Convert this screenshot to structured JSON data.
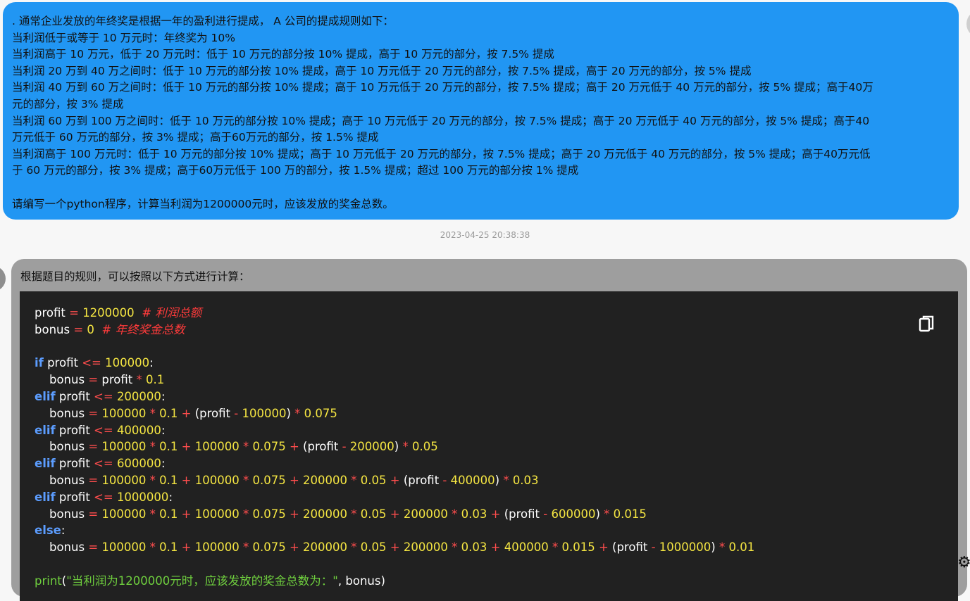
{
  "user_message": {
    "lines": [
      ". 通常企业发放的年终奖是根据一年的盈利进行提成， A 公司的提成规则如下：",
      "当利润低于或等于 10 万元时：年终奖为 10%",
      "当利润高于 10 万元，低于 20 万元时：低于 10 万元的部分按 10% 提成，高于 10 万元的部分，按 7.5% 提成",
      "当利润 20 万到 40 万之间时：低于 10 万元的部分按 10% 提成，高于 10 万元低于 20 万元的部分，按 7.5% 提成，高于 20 万元的部分，按 5% 提成",
      "当利润 40 万到 60 万之间时：低于 10 万元的部分按 10% 提成；高于 10 万元低于 20 万元的部分，按 7.5% 提成；高于 20 万元低于 40 万元的部分，按 5% 提成；高于40万",
      "元的部分，按 3% 提成",
      "当利润 60 万到 100 万之间时：低于 10 万元的部分按 10% 提成；高于 10 万元低于 20 万元的部分，按 7.5% 提成；高于 20 万元低于 40 万元的部分，按 5% 提成；高于40",
      "万元低于 60 万元的部分，按 3% 提成；高于60万元的部分，按 1.5% 提成",
      "当利润高于 100 万元时：低于 10 万元的部分按 10% 提成；高于 10 万元低于 20 万元的部分，按 7.5% 提成；高于 20 万元低于 40 万元的部分，按 5% 提成；高于40万元低",
      "于 60 万元的部分，按 3% 提成；高于60万元低于 100 万的部分，按 1.5% 提成；超过 100 万元的部分按 1% 提成",
      "",
      "请编写一个python程序，计算当利润为1200000元时，应该发放的奖金总数。"
    ]
  },
  "timestamp": "2023-04-25 20:38:38",
  "bot_message": {
    "intro": "根据题目的规则，可以按照以下方式进行计算：",
    "code": [
      [
        [
          "profit ",
          ""
        ],
        [
          "=",
          "op"
        ],
        [
          " ",
          ""
        ],
        [
          "1200000",
          "num"
        ],
        [
          "  ",
          ""
        ],
        [
          "# 利润总额",
          "cm"
        ]
      ],
      [
        [
          "bonus ",
          ""
        ],
        [
          "=",
          "op"
        ],
        [
          " ",
          ""
        ],
        [
          "0",
          "num"
        ],
        [
          "  ",
          ""
        ],
        [
          "# 年终奖金总数",
          "cm"
        ]
      ],
      [],
      [
        [
          "if",
          "kw"
        ],
        [
          " profit ",
          ""
        ],
        [
          "<=",
          "op"
        ],
        [
          " ",
          ""
        ],
        [
          "100000",
          "num"
        ],
        [
          ":",
          ""
        ]
      ],
      [
        [
          "    bonus ",
          ""
        ],
        [
          "=",
          "op"
        ],
        [
          " profit ",
          ""
        ],
        [
          "*",
          "op"
        ],
        [
          " ",
          ""
        ],
        [
          "0.1",
          "num"
        ]
      ],
      [
        [
          "elif",
          "kw"
        ],
        [
          " profit ",
          ""
        ],
        [
          "<=",
          "op"
        ],
        [
          " ",
          ""
        ],
        [
          "200000",
          "num"
        ],
        [
          ":",
          ""
        ]
      ],
      [
        [
          "    bonus ",
          ""
        ],
        [
          "=",
          "op"
        ],
        [
          " ",
          ""
        ],
        [
          "100000",
          "num"
        ],
        [
          " ",
          ""
        ],
        [
          "*",
          "op"
        ],
        [
          " ",
          ""
        ],
        [
          "0.1",
          "num"
        ],
        [
          " ",
          ""
        ],
        [
          "+",
          "op"
        ],
        [
          " (profit ",
          ""
        ],
        [
          "-",
          "op"
        ],
        [
          " ",
          ""
        ],
        [
          "100000",
          "num"
        ],
        [
          ") ",
          ""
        ],
        [
          "*",
          "op"
        ],
        [
          " ",
          ""
        ],
        [
          "0.075",
          "num"
        ]
      ],
      [
        [
          "elif",
          "kw"
        ],
        [
          " profit ",
          ""
        ],
        [
          "<=",
          "op"
        ],
        [
          " ",
          ""
        ],
        [
          "400000",
          "num"
        ],
        [
          ":",
          ""
        ]
      ],
      [
        [
          "    bonus ",
          ""
        ],
        [
          "=",
          "op"
        ],
        [
          " ",
          ""
        ],
        [
          "100000",
          "num"
        ],
        [
          " ",
          ""
        ],
        [
          "*",
          "op"
        ],
        [
          " ",
          ""
        ],
        [
          "0.1",
          "num"
        ],
        [
          " ",
          ""
        ],
        [
          "+",
          "op"
        ],
        [
          " ",
          ""
        ],
        [
          "100000",
          "num"
        ],
        [
          " ",
          ""
        ],
        [
          "*",
          "op"
        ],
        [
          " ",
          ""
        ],
        [
          "0.075",
          "num"
        ],
        [
          " ",
          ""
        ],
        [
          "+",
          "op"
        ],
        [
          " (profit ",
          ""
        ],
        [
          "-",
          "op"
        ],
        [
          " ",
          ""
        ],
        [
          "200000",
          "num"
        ],
        [
          ") ",
          ""
        ],
        [
          "*",
          "op"
        ],
        [
          " ",
          ""
        ],
        [
          "0.05",
          "num"
        ]
      ],
      [
        [
          "elif",
          "kw"
        ],
        [
          " profit ",
          ""
        ],
        [
          "<=",
          "op"
        ],
        [
          " ",
          ""
        ],
        [
          "600000",
          "num"
        ],
        [
          ":",
          ""
        ]
      ],
      [
        [
          "    bonus ",
          ""
        ],
        [
          "=",
          "op"
        ],
        [
          " ",
          ""
        ],
        [
          "100000",
          "num"
        ],
        [
          " ",
          ""
        ],
        [
          "*",
          "op"
        ],
        [
          " ",
          ""
        ],
        [
          "0.1",
          "num"
        ],
        [
          " ",
          ""
        ],
        [
          "+",
          "op"
        ],
        [
          " ",
          ""
        ],
        [
          "100000",
          "num"
        ],
        [
          " ",
          ""
        ],
        [
          "*",
          "op"
        ],
        [
          " ",
          ""
        ],
        [
          "0.075",
          "num"
        ],
        [
          " ",
          ""
        ],
        [
          "+",
          "op"
        ],
        [
          " ",
          ""
        ],
        [
          "200000",
          "num"
        ],
        [
          " ",
          ""
        ],
        [
          "*",
          "op"
        ],
        [
          " ",
          ""
        ],
        [
          "0.05",
          "num"
        ],
        [
          " ",
          ""
        ],
        [
          "+",
          "op"
        ],
        [
          " (profit ",
          ""
        ],
        [
          "-",
          "op"
        ],
        [
          " ",
          ""
        ],
        [
          "400000",
          "num"
        ],
        [
          ") ",
          ""
        ],
        [
          "*",
          "op"
        ],
        [
          " ",
          ""
        ],
        [
          "0.03",
          "num"
        ]
      ],
      [
        [
          "elif",
          "kw"
        ],
        [
          " profit ",
          ""
        ],
        [
          "<=",
          "op"
        ],
        [
          " ",
          ""
        ],
        [
          "1000000",
          "num"
        ],
        [
          ":",
          ""
        ]
      ],
      [
        [
          "    bonus ",
          ""
        ],
        [
          "=",
          "op"
        ],
        [
          " ",
          ""
        ],
        [
          "100000",
          "num"
        ],
        [
          " ",
          ""
        ],
        [
          "*",
          "op"
        ],
        [
          " ",
          ""
        ],
        [
          "0.1",
          "num"
        ],
        [
          " ",
          ""
        ],
        [
          "+",
          "op"
        ],
        [
          " ",
          ""
        ],
        [
          "100000",
          "num"
        ],
        [
          " ",
          ""
        ],
        [
          "*",
          "op"
        ],
        [
          " ",
          ""
        ],
        [
          "0.075",
          "num"
        ],
        [
          " ",
          ""
        ],
        [
          "+",
          "op"
        ],
        [
          " ",
          ""
        ],
        [
          "200000",
          "num"
        ],
        [
          " ",
          ""
        ],
        [
          "*",
          "op"
        ],
        [
          " ",
          ""
        ],
        [
          "0.05",
          "num"
        ],
        [
          " ",
          ""
        ],
        [
          "+",
          "op"
        ],
        [
          " ",
          ""
        ],
        [
          "200000",
          "num"
        ],
        [
          " ",
          ""
        ],
        [
          "*",
          "op"
        ],
        [
          " ",
          ""
        ],
        [
          "0.03",
          "num"
        ],
        [
          " ",
          ""
        ],
        [
          "+",
          "op"
        ],
        [
          " (profit ",
          ""
        ],
        [
          "-",
          "op"
        ],
        [
          " ",
          ""
        ],
        [
          "600000",
          "num"
        ],
        [
          ") ",
          ""
        ],
        [
          "*",
          "op"
        ],
        [
          " ",
          ""
        ],
        [
          "0.015",
          "num"
        ]
      ],
      [
        [
          "else",
          "kw"
        ],
        [
          ":",
          ""
        ]
      ],
      [
        [
          "    bonus ",
          ""
        ],
        [
          "=",
          "op"
        ],
        [
          " ",
          ""
        ],
        [
          "100000",
          "num"
        ],
        [
          " ",
          ""
        ],
        [
          "*",
          "op"
        ],
        [
          " ",
          ""
        ],
        [
          "0.1",
          "num"
        ],
        [
          " ",
          ""
        ],
        [
          "+",
          "op"
        ],
        [
          " ",
          ""
        ],
        [
          "100000",
          "num"
        ],
        [
          " ",
          ""
        ],
        [
          "*",
          "op"
        ],
        [
          " ",
          ""
        ],
        [
          "0.075",
          "num"
        ],
        [
          " ",
          ""
        ],
        [
          "+",
          "op"
        ],
        [
          " ",
          ""
        ],
        [
          "200000",
          "num"
        ],
        [
          " ",
          ""
        ],
        [
          "*",
          "op"
        ],
        [
          " ",
          ""
        ],
        [
          "0.05",
          "num"
        ],
        [
          " ",
          ""
        ],
        [
          "+",
          "op"
        ],
        [
          " ",
          ""
        ],
        [
          "200000",
          "num"
        ],
        [
          " ",
          ""
        ],
        [
          "*",
          "op"
        ],
        [
          " ",
          ""
        ],
        [
          "0.03",
          "num"
        ],
        [
          " ",
          ""
        ],
        [
          "+",
          "op"
        ],
        [
          " ",
          ""
        ],
        [
          "400000",
          "num"
        ],
        [
          " ",
          ""
        ],
        [
          "*",
          "op"
        ],
        [
          " ",
          ""
        ],
        [
          "0.015",
          "num"
        ],
        [
          " ",
          ""
        ],
        [
          "+",
          "op"
        ],
        [
          " (profit ",
          ""
        ],
        [
          "-",
          "op"
        ],
        [
          " ",
          ""
        ],
        [
          "1000000",
          "num"
        ],
        [
          ") ",
          ""
        ],
        [
          "*",
          "op"
        ],
        [
          " ",
          ""
        ],
        [
          "0.01",
          "num"
        ]
      ],
      [],
      [
        [
          "print",
          "fn"
        ],
        [
          "(",
          ""
        ],
        [
          "\"当利润为1200000元时，应该发放的奖金总数为：\"",
          "str"
        ],
        [
          ", bonus)",
          ""
        ]
      ]
    ]
  },
  "icons": {
    "copy": "copy-icon",
    "settings": "gear-icon"
  },
  "colors": {
    "user_bubble": "#2196f3",
    "bot_bubble": "#9e9e9e",
    "code_bg": "#212121"
  }
}
